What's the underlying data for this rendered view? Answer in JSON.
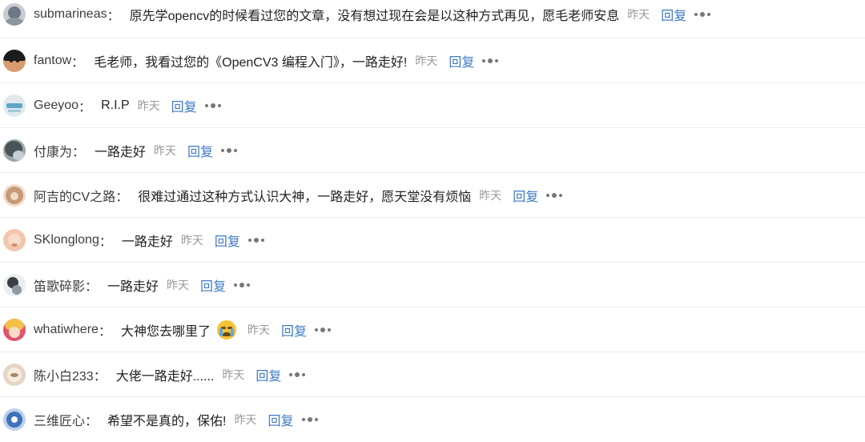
{
  "comments": [
    {
      "username": "submarineas",
      "content": "原先学opencv的时候看过您的文章，没有想过现在会是以这种方式再见，愿毛老师安息",
      "time": "昨天",
      "reply": "回复",
      "avatar_colors": [
        "#6d7a86",
        "#c9cdd2"
      ]
    },
    {
      "username": "fantow",
      "content": "毛老师，我看过您的《OpenCV3 编程入门》，一路走好!",
      "time": "昨天",
      "reply": "回复",
      "avatar_colors": [
        "#1b1b1b",
        "#d79b6d"
      ]
    },
    {
      "username": "Geeyoo",
      "content": "R.I.P",
      "time": "昨天",
      "reply": "回复",
      "avatar_colors": [
        "#dfe9ee",
        "#5fa7c8"
      ]
    },
    {
      "username": "付康为",
      "content": "一路走好",
      "time": "昨天",
      "reply": "回复",
      "avatar_colors": [
        "#4a5358",
        "#9aa7ad"
      ]
    },
    {
      "username": "阿吉的CV之路",
      "content": "很难过通过这种方式认识大神，一路走好，愿天堂没有烦恼",
      "time": "昨天",
      "reply": "回复",
      "avatar_colors": [
        "#c59a78",
        "#f1dcc8"
      ]
    },
    {
      "username": "SKlonglong",
      "content": "一路走好",
      "time": "昨天",
      "reply": "回复",
      "avatar_colors": [
        "#f0c7ae",
        "#d98a6a"
      ]
    },
    {
      "username": "笛歌碎影",
      "content": "一路走好",
      "time": "昨天",
      "reply": "回复",
      "avatar_colors": [
        "#e9eef1",
        "#3b3f45"
      ]
    },
    {
      "username": "whatiwhere",
      "content": "大神您去哪里了",
      "time": "昨天",
      "reply": "回复",
      "avatar_colors": [
        "#f2c046",
        "#e0556f"
      ],
      "emoji": "crying-face-icon"
    },
    {
      "username": "陈小白233",
      "content": "大佬一路走好......",
      "time": "昨天",
      "reply": "回复",
      "avatar_colors": [
        "#e6d5c3",
        "#a98765"
      ]
    },
    {
      "username": "三维匠心",
      "content": "希望不是真的，保佑!",
      "time": "昨天",
      "reply": "回复",
      "avatar_colors": [
        "#3f72b8",
        "#bcd0ea"
      ]
    }
  ],
  "colon": "：",
  "colors": {
    "reply": "#3e79c6",
    "time": "#999999",
    "divider": "#ececec"
  }
}
